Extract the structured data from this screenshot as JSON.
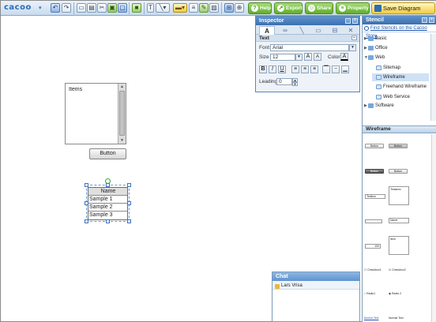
{
  "app": {
    "logo": "cacoo",
    "logo_caret": "▾"
  },
  "toolbar": {
    "help_label": "Help",
    "export_label": "Export",
    "share_label": "Share",
    "property_label": "Property",
    "save_label": "Save Diagram"
  },
  "canvas": {
    "list_label": "Items",
    "button_label": "Button",
    "table": {
      "header": "Name",
      "rows": [
        "Sample 1",
        "Sample 2",
        "Sample 3"
      ]
    }
  },
  "inspector": {
    "title": "Inspector",
    "section": "Text",
    "font_label": "Font",
    "font_value": "Arial",
    "size_label": "Size",
    "size_value": "12",
    "color_label": "Color",
    "leading_label": "Leading",
    "leading_value": "0",
    "tabs": [
      "A"
    ]
  },
  "stencil": {
    "title": "Stencil",
    "find_link": "Find Stencils on the Cacoo Store",
    "tree": [
      {
        "label": "Basic"
      },
      {
        "label": "Office"
      },
      {
        "label": "Web"
      },
      {
        "label": "Sitemap"
      },
      {
        "label": "Wireframe"
      },
      {
        "label": "Freehand Wireframe"
      },
      {
        "label": "Web Service"
      },
      {
        "label": "Software"
      }
    ],
    "section_title": "Wireframe",
    "samples": {
      "button": "Button",
      "textbox": "Textbox",
      "textarea": "Textarea",
      "name": "Name",
      "number": "100",
      "item": "Item",
      "checkbox1": "Checkbox1",
      "checkbox2": "Checkbox2",
      "radio1": "Radio1",
      "radio2": "Radio 2",
      "anchor": "Anchor Text",
      "normal": "Normal Text"
    }
  },
  "chat": {
    "title": "Chat",
    "user": "Lars Vrisa"
  },
  "colors": {
    "accent": "#3b6fae",
    "toolbar_green": "#5fae2b",
    "save_yellow": "#f3cd3b",
    "selection": "#3d72c4"
  }
}
